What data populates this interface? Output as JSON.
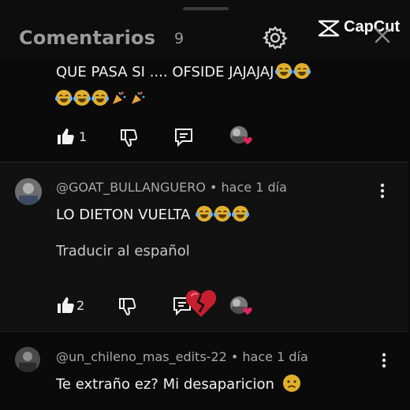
{
  "header": {
    "title": "Comentarios",
    "count": "9",
    "logo_text": "CapCut"
  },
  "comments": [
    {
      "text_line1": "QUE PASA SI .... OFSIDE JAJAJAJ",
      "likes": "1"
    },
    {
      "author": "@GOAT_BULLANGUERO",
      "time": "• hace 1 día",
      "text": "LO DIETON VUELTA",
      "translate": "Traducir al español",
      "likes": "2"
    },
    {
      "author": "@un_chileno_mas_edits-22",
      "time": "• hace 1 día",
      "text": "Te extraño ez? Mi desaparicion"
    }
  ],
  "colors": {
    "background": "#0a0a0a",
    "card": "#111111",
    "heart": "#e0245e",
    "emoji": "#e0b02c"
  },
  "icons": [
    "gear-icon",
    "close-icon",
    "thumbs-up-icon",
    "thumbs-down-icon",
    "reply-icon",
    "kebab-menu-icon",
    "broken-heart-icon"
  ]
}
